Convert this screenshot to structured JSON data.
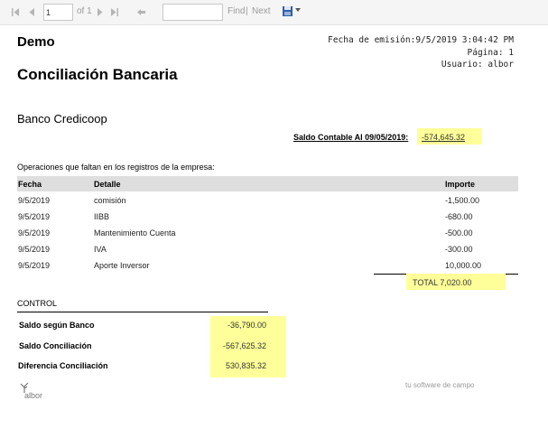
{
  "toolbar": {
    "page_value": "1",
    "page_of": "of 1",
    "find_label": "Find",
    "separator": "|",
    "next_label": "Next",
    "find_value": ""
  },
  "report": {
    "company": "Demo",
    "title": "Conciliación Bancaria",
    "meta": {
      "emission": "Fecha de emisión:9/5/2019 3:04:42 PM",
      "page": "Página: 1",
      "user": "Usuario: albor"
    },
    "bank": "Banco Credicoop",
    "saldo_contable_label": "Saldo Contable Al 09/05/2019:",
    "saldo_contable_value": "-574,645.32",
    "operations_title": "Operaciones que faltan en los registros de la empresa:",
    "columns": {
      "fecha": "Fecha",
      "detalle": "Detalle",
      "importe": "Importe"
    },
    "rows": [
      {
        "fecha": "9/5/2019",
        "detalle": "comisión",
        "importe": "-1,500.00"
      },
      {
        "fecha": "9/5/2019",
        "detalle": "IIBB",
        "importe": "-680.00"
      },
      {
        "fecha": "9/5/2019",
        "detalle": "Mantenimiento Cuenta",
        "importe": "-500.00"
      },
      {
        "fecha": "9/5/2019",
        "detalle": "IVA",
        "importe": "-300.00"
      },
      {
        "fecha": "9/5/2019",
        "detalle": "Aporte Inversor",
        "importe": "10,000.00"
      }
    ],
    "total": "TOTAL 7,020.00",
    "control": {
      "title": "CONTROL",
      "items": [
        {
          "label": "Saldo según Banco",
          "value": "-36,790.00"
        },
        {
          "label": "Saldo Conciliación",
          "value": "-567,625.32"
        },
        {
          "label": "Diferencia Conciliación",
          "value": "530,835.32"
        }
      ]
    },
    "logo_text": "albor",
    "tagline": "tu software de campo",
    "highlight_color": "#ffff99"
  }
}
